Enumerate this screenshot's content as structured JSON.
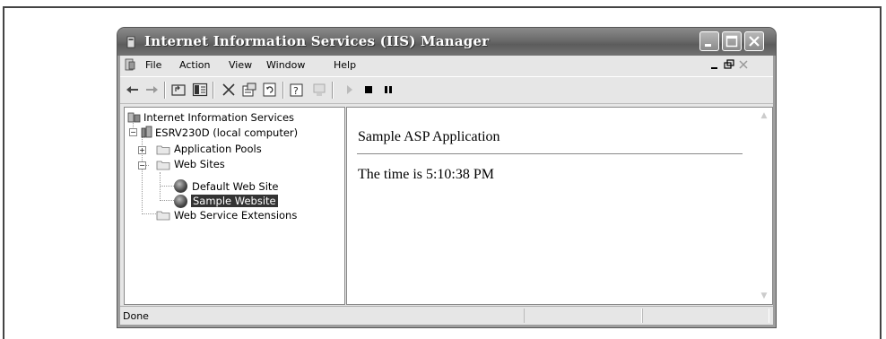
{
  "window": {
    "title": "Internet Information Services (IIS) Manager"
  },
  "menubar": {
    "items": [
      {
        "label": "File"
      },
      {
        "label": "Action"
      },
      {
        "label": "View"
      },
      {
        "label": "Window"
      },
      {
        "label": "Help"
      }
    ]
  },
  "toolbar": {
    "icons": [
      "back-arrow-icon",
      "forward-arrow-icon",
      "up-folder-icon",
      "show-hide-tree-icon",
      "delete-icon",
      "properties-icon",
      "refresh-icon",
      "help-icon",
      "computer-icon",
      "start-icon",
      "stop-icon",
      "pause-icon"
    ]
  },
  "tree": {
    "root": "Internet Information Services",
    "server": "ESRV230D (local computer)",
    "app_pools": "Application Pools",
    "web_sites": "Web Sites",
    "default_site": "Default Web Site",
    "sample_site": "Sample Website",
    "extensions": "Web Service Extensions",
    "selected": "Sample Website"
  },
  "content": {
    "title": "Sample ASP Application",
    "time_text": "The time is 5:10:38 PM"
  },
  "status": {
    "text": "Done"
  }
}
